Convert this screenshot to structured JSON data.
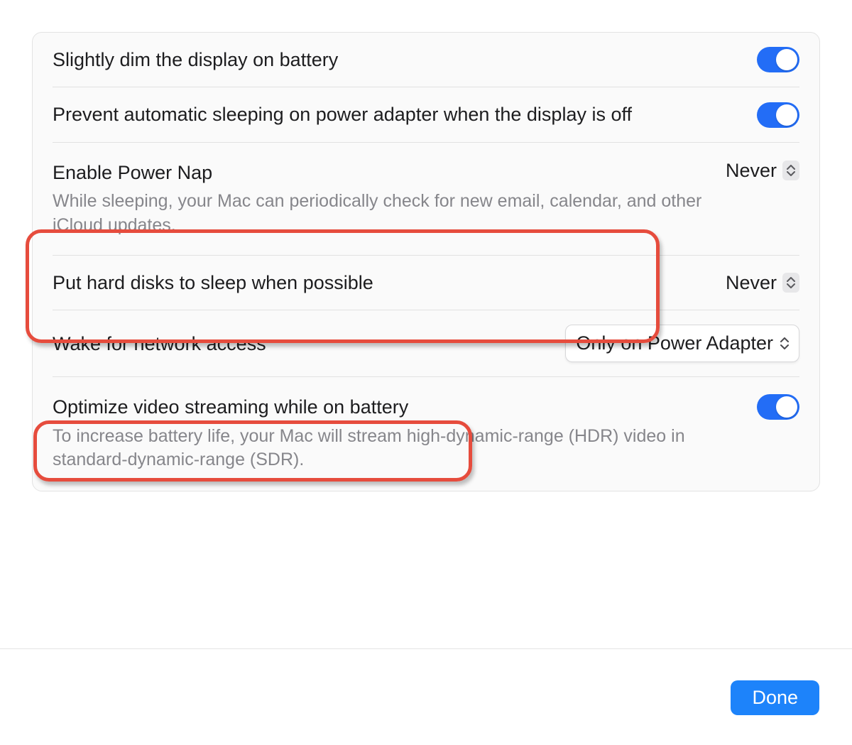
{
  "colors": {
    "accent": "#236df6",
    "highlight": "#e64c3d",
    "done_button": "#1d83fa"
  },
  "settings": {
    "dim_display": {
      "label": "Slightly dim the display on battery",
      "enabled": true
    },
    "prevent_sleep": {
      "label": "Prevent automatic sleeping on power adapter when the display is off",
      "enabled": true
    },
    "power_nap": {
      "label": "Enable Power Nap",
      "description": "While sleeping, your Mac can periodically check for new email, calendar, and other iCloud updates.",
      "value": "Never"
    },
    "hard_disks": {
      "label": "Put hard disks to sleep when possible",
      "value": "Never"
    },
    "wake_network": {
      "label": "Wake for network access",
      "value": "Only on Power Adapter"
    },
    "optimize_video": {
      "label": "Optimize video streaming while on battery",
      "description": "To increase battery life, your Mac will stream high-dynamic-range (HDR) video in standard-dynamic-range (SDR).",
      "enabled": true
    }
  },
  "footer": {
    "done_label": "Done"
  }
}
